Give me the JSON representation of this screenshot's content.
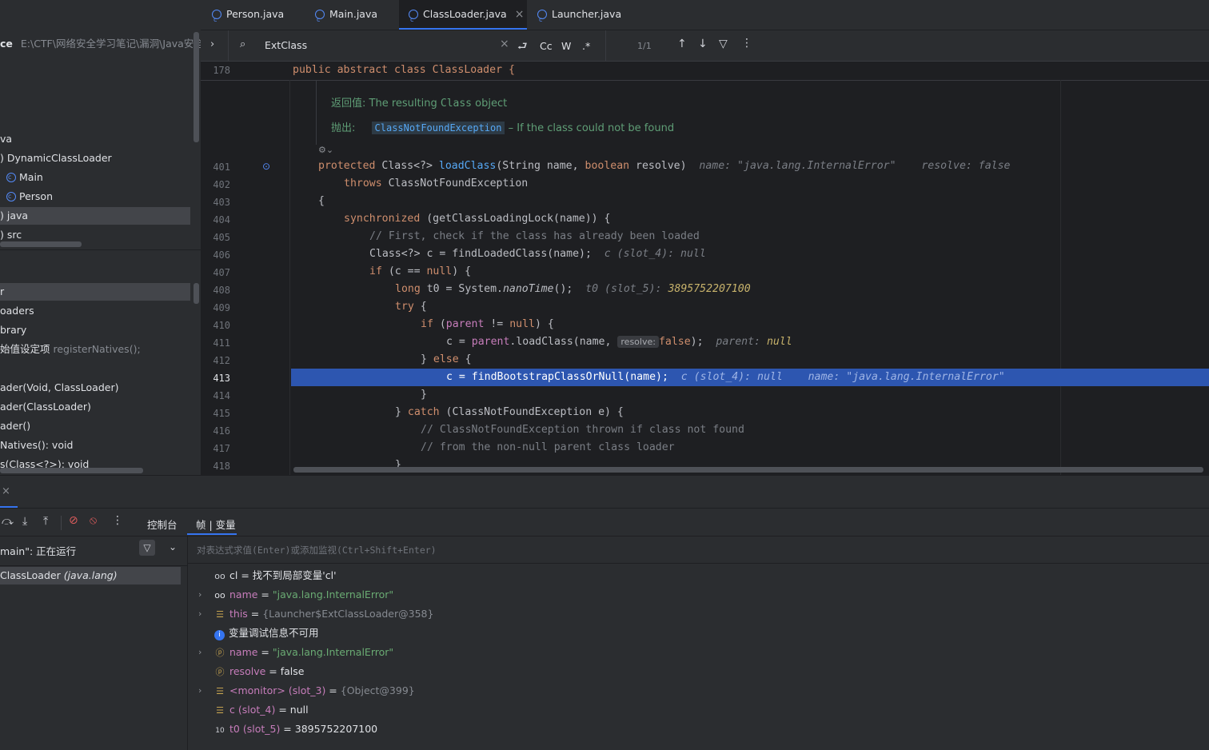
{
  "project": {
    "path_title": "ce",
    "path": "E:\\CTF\\网络安全学习笔记\\漏洞\\Java安全\\",
    "items": [
      {
        "label": "va"
      },
      {
        "label": ") DynamicClassLoader"
      },
      {
        "label": "Main"
      },
      {
        "label": "Person"
      },
      {
        "label": ") java"
      },
      {
        "label": ") src"
      }
    ]
  },
  "structure": {
    "items": [
      {
        "label": "r"
      },
      {
        "label": "oaders"
      },
      {
        "label": "brary"
      },
      {
        "label": "始值设定项",
        "detail": "registerNatives();"
      },
      {
        "label": "ader(Void, ClassLoader)"
      },
      {
        "label": "ader(ClassLoader)"
      },
      {
        "label": "ader()"
      },
      {
        "label": "Natives(): void"
      },
      {
        "label": "s(Class<?>): void"
      }
    ]
  },
  "tabs": [
    {
      "label": "Person.java"
    },
    {
      "label": "Main.java"
    },
    {
      "label": "ClassLoader.java",
      "close": "×"
    },
    {
      "label": "Launcher.java"
    }
  ],
  "find": {
    "query": "ExtClass",
    "clear": "×",
    "match_case": "Cc",
    "words": "W",
    "regex": ".*",
    "count": "1/1"
  },
  "editor": {
    "sticky_line": "178",
    "sticky_code": "public abstract class ClassLoader {",
    "doc_returns_label": "返回值:",
    "doc_returns_text": "The resulting",
    "doc_returns_code": "Class",
    "doc_returns_tail": "object",
    "doc_throws_label": "抛出:",
    "doc_throws_code": "ClassNotFoundException",
    "doc_throws_text": "– If the class could not be found",
    "lines": [
      "401",
      "402",
      "403",
      "404",
      "405",
      "406",
      "407",
      "408",
      "409",
      "410",
      "411",
      "412",
      "413",
      "414",
      "415",
      "416",
      "417",
      "418"
    ],
    "hint_401_name": "name: \"java.lang.InternalError\"",
    "hint_401_resolve": "resolve: false",
    "comment_405": "// First, check if the class has already been loaded",
    "hint_406": "c (slot_4): null",
    "hint_408_label": "t0 (slot_5):",
    "hint_408_value": "3895752207100",
    "inlay_411": "resolve:",
    "hint_411_label": "parent:",
    "hint_411_value": "null",
    "hint_413_c": "c (slot_4): null",
    "hint_413_name": "name: \"java.lang.InternalError\"",
    "comment_416": "// ClassNotFoundException thrown if class not found",
    "comment_417": "// from the non-null parent class loader"
  },
  "debug": {
    "close": "×",
    "tab_console": "控制台",
    "tab_frames": "帧 | 变量",
    "thread": "main\": 正在运行",
    "frame": "ClassLoader",
    "frame_pkg": "(java.lang)",
    "eval_placeholder": "对表达式求值(Enter)或添加监视(Ctrl+Shift+Enter)",
    "vars": [
      {
        "name": "cl",
        "eq": " = ",
        "value": "找不到局部变量'cl'"
      },
      {
        "name": "name",
        "eq": " = ",
        "value": "\"java.lang.InternalError\""
      },
      {
        "name": "this",
        "eq": " = ",
        "value": "{Launcher$ExtClassLoader@358}"
      },
      {
        "name": "",
        "eq": "",
        "value": "变量调试信息不可用"
      },
      {
        "name": "name",
        "eq": " = ",
        "value": "\"java.lang.InternalError\""
      },
      {
        "name": "resolve",
        "eq": " = ",
        "value": "false"
      },
      {
        "name": "<monitor> (slot_3)",
        "eq": " = ",
        "value": "{Object@399}"
      },
      {
        "name": "c (slot_4)",
        "eq": " = ",
        "value": "null"
      },
      {
        "name": "t0 (slot_5)",
        "eq": " = ",
        "value": "3895752207100"
      }
    ]
  },
  "colors": {
    "accent": "#3574f0",
    "selection": "#2d56b0",
    "string": "#6aab73",
    "keyword": "#cf8e6d"
  }
}
